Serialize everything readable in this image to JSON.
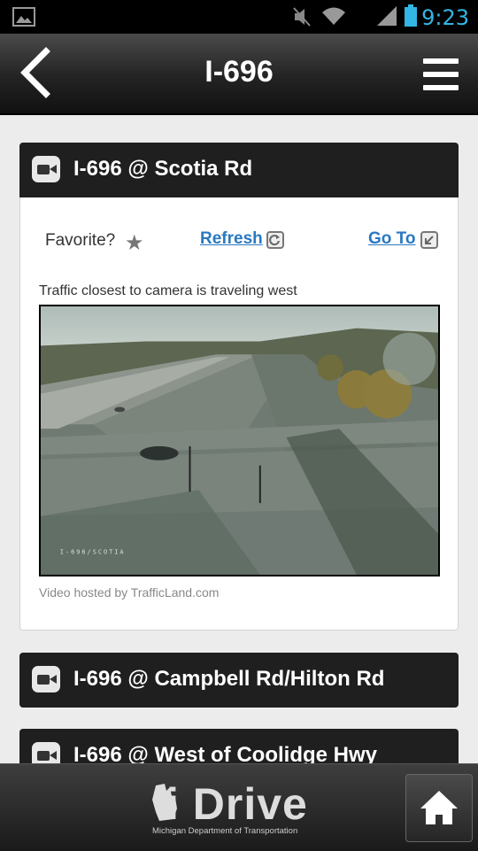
{
  "status_bar": {
    "time": "9:23",
    "icons": [
      "image-icon",
      "mute-icon",
      "wifi-icon",
      "signal-icon",
      "battery-icon"
    ]
  },
  "header": {
    "title": "I-696",
    "back_icon": "back-chevron-icon",
    "menu_icon": "hamburger-menu-icon"
  },
  "cameras": [
    {
      "title": "I-696 @ Scotia Rd",
      "expanded": true,
      "favorite_label": "Favorite?",
      "refresh_label": "Refresh",
      "goto_label": "Go To",
      "direction_text": "Traffic closest to camera is traveling west",
      "image_caption": "I-696/SCOTIA",
      "hosted_text": "Video hosted by TrafficLand.com"
    },
    {
      "title": "I-696 @ Campbell Rd/Hilton Rd",
      "expanded": false
    },
    {
      "title": "I-696 @ West of Coolidge Hwy",
      "expanded": false
    }
  ],
  "footer": {
    "logo_text": "i Drive",
    "logo_subtext": "Michigan Department of Transportation",
    "home_icon": "home-icon"
  },
  "colors": {
    "accent_blue": "#33b5e5",
    "link_blue": "#2a78c0",
    "card_header": "#1f1f1f"
  }
}
